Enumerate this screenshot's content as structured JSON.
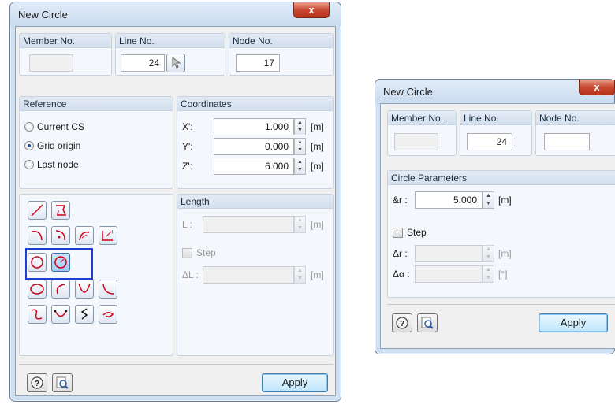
{
  "dialog1": {
    "title": "New Circle",
    "close_label": "x",
    "member_no_label": "Member No.",
    "member_no_value": "",
    "line_no_label": "Line No.",
    "line_no_value": "24",
    "node_no_label": "Node No.",
    "node_no_value": "17",
    "reference": {
      "header": "Reference",
      "options": [
        "Current CS",
        "Grid origin",
        "Last node"
      ],
      "selected": "Grid origin"
    },
    "coordinates": {
      "header": "Coordinates",
      "rows": [
        {
          "label": "X':",
          "value": "1.000",
          "unit": "[m]"
        },
        {
          "label": "Y':",
          "value": "0.000",
          "unit": "[m]"
        },
        {
          "label": "Z':",
          "value": "6.000",
          "unit": "[m]"
        }
      ]
    },
    "length": {
      "header": "Length",
      "l_label": "L :",
      "l_unit": "[m]",
      "step_label": "Step",
      "dl_label": "ΔL :",
      "dl_unit": "[m]"
    },
    "apply_label": "Apply"
  },
  "dialog2": {
    "title": "New Circle",
    "close_label": "x",
    "member_no_label": "Member No.",
    "line_no_label": "Line No.",
    "line_no_value": "24",
    "node_no_label": "Node No.",
    "circle_params": {
      "header": "Circle Parameters",
      "r_label": "&r :",
      "r_value": "5.000",
      "r_unit": "[m]",
      "step_label": "Step",
      "dr_label": "Δr :",
      "dr_unit": "[m]",
      "da_label": "Δα :",
      "da_unit": "[°]"
    },
    "apply_label": "Apply"
  },
  "colors": {
    "window_frame": "#cfe0f2",
    "close_button": "#c94a32",
    "highlight_border": "#1f3fd1",
    "tool_icon": "#d0021b"
  }
}
